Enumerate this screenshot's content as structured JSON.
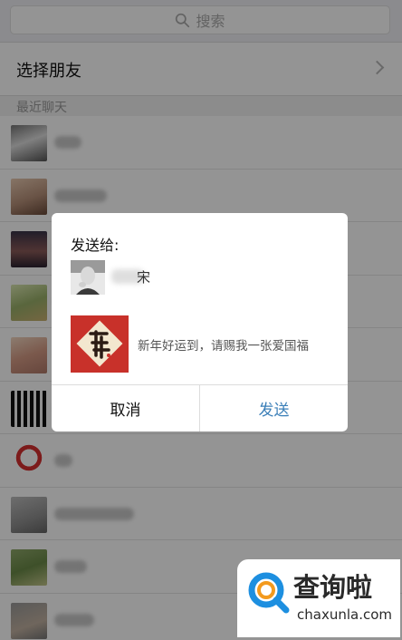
{
  "search": {
    "placeholder": "搜索"
  },
  "select_friend": {
    "label": "选择朋友"
  },
  "recent": {
    "header": "最近聊天"
  },
  "contacts": [
    {
      "avatar": "man-photo"
    },
    {
      "avatar": "person-photo"
    },
    {
      "avatar": "sunset-photo"
    },
    {
      "avatar": "scenery-photo"
    },
    {
      "avatar": "girl-photo"
    },
    {
      "avatar": "crowd-photo"
    },
    {
      "avatar": "doraemon-photo"
    },
    {
      "avatar": "person-photo-2"
    },
    {
      "avatar": "green-photo"
    },
    {
      "avatar": "person-photo-3"
    }
  ],
  "dialog": {
    "title": "发送给:",
    "recipient_tail": "宋",
    "share_text": "新年好运到，请赐我一张爱国福",
    "cancel_label": "取消",
    "send_label": "发送"
  },
  "watermark": {
    "name": "查询啦",
    "domain": "chaxunla.com"
  },
  "colors": {
    "send": "#3b7fb8",
    "fu_card": "#c8312a",
    "logo_blue": "#1d8fe0",
    "logo_orange": "#f39a1e"
  }
}
